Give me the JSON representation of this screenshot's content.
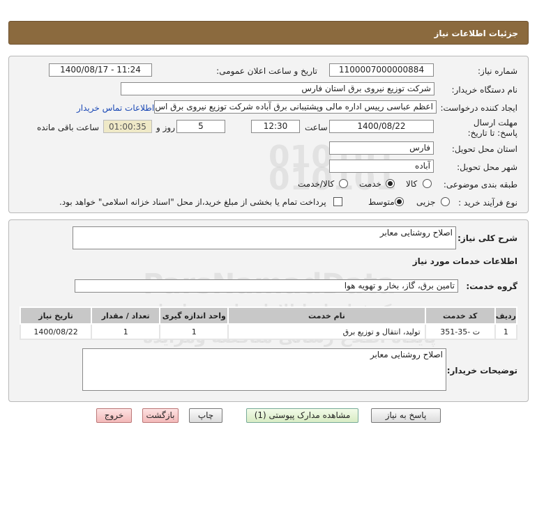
{
  "header": {
    "title": "جزئیات اطلاعات نیاز"
  },
  "form": {
    "need_number_label": "شماره نیاز:",
    "need_number": "1100007000000884",
    "announce_label": "تاریخ و ساعت اعلان عمومی:",
    "announce_value": "1400/08/17 - 11:24",
    "buyer_org_label": "نام دستگاه خریدار:",
    "buyer_org": "شرکت توزیع نیروی برق استان فارس",
    "creator_label": "ایجاد کننده درخواست:",
    "creator": "اعظم  عباسی رییس اداره مالی وپشتیبانی برق آباده شرکت توزیع نیروی برق اس",
    "contact_link": "اطلاعات تماس خریدار",
    "deadline_label": "مهلت ارسال پاسخ: تا تاریخ:",
    "deadline_date": "1400/08/22",
    "time_label": "ساعت",
    "deadline_time": "12:30",
    "days_value": "5",
    "days_label": "روز و",
    "remaining_time": "01:00:35",
    "remaining_label": "ساعت باقی مانده",
    "province_label": "استان محل تحویل:",
    "province": "فارس",
    "city_label": "شهر محل تحویل:",
    "city": "آباده",
    "category_label": "طبقه بندی موضوعی:",
    "category_options": [
      "کالا",
      "خدمت",
      "کالا/خدمت"
    ],
    "category_selected": "خدمت",
    "purchase_type_label": "نوع فرآیند خرید :",
    "purchase_options": [
      "جزیی",
      "متوسط"
    ],
    "purchase_selected": "متوسط",
    "payment_note": "پرداخت تمام یا بخشی از مبلغ خرید،از محل \"اسناد خزانه اسلامی\" خواهد بود."
  },
  "details": {
    "summary_label": "شرح کلی نیاز:",
    "summary": "اصلاح روشنایی معابر",
    "services_heading": "اطلاعات خدمات مورد نیاز",
    "service_group_label": "گروه خدمت:",
    "service_group": "تامین برق، گاز، بخار و تهویه هوا",
    "table": {
      "headers": [
        "ردیف",
        "کد خدمت",
        "نام خدمت",
        "واحد اندازه گیری",
        "تعداد / مقدار",
        "تاریخ نیاز"
      ],
      "rows": [
        [
          "1",
          "ت -35-351",
          "تولید، انتقال و توزیع برق",
          "1",
          "1",
          "1400/08/22"
        ]
      ]
    },
    "buyer_notes_label": "توضیحات خریدار:",
    "buyer_notes": "اصلاح روشنایی معابر"
  },
  "buttons": {
    "reply": "پاسخ به نیاز",
    "attachments": "مشاهده مدارک پیوستی (1)",
    "print": "چاپ",
    "back": "بازگشت",
    "exit": "خروج"
  },
  "watermark": {
    "digits": "010101",
    "brand": "ParsNamadData",
    "phone": "۰۲۱-۸۸۳۴۹۶۷۰-۵",
    "line1": "مرکز فراخوان اطلاعات پارس نماد داده",
    "line2": "پایگاه اطلاع رسانی مناقصه ومزایده"
  }
}
